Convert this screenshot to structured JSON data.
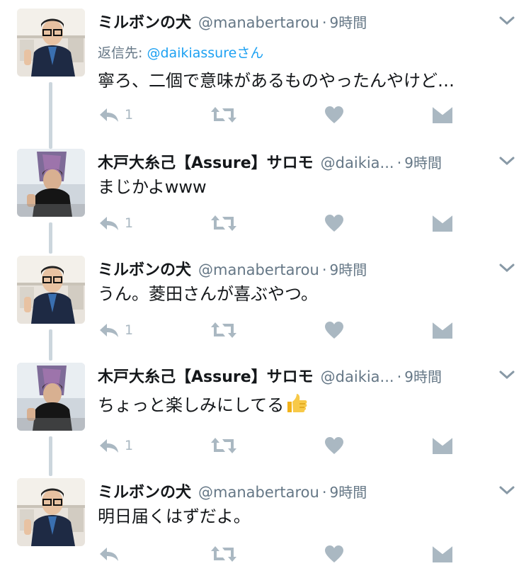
{
  "tweets": [
    {
      "name": "ミルボンの犬",
      "handle": "@manabertarou",
      "time": "9時間",
      "reply_prefix": "返信先: ",
      "reply_mention": "@daikiassure",
      "reply_suffix": "さん",
      "text": "寧ろ、二個で意味があるものやったんやけど…",
      "reply_count": "1",
      "avatar": "man-glasses-avatar"
    },
    {
      "name": "木戸大糸己【Assure】サロモ",
      "handle": "@daikia...",
      "time": "9時間",
      "text": "まじかよwww",
      "reply_count": "1",
      "avatar": "salon-avatar"
    },
    {
      "name": "ミルボンの犬",
      "handle": "@manabertarou",
      "time": "9時間",
      "text": "うん。菱田さんが喜ぶやつ。",
      "reply_count": "1",
      "avatar": "man-glasses-avatar"
    },
    {
      "name": "木戸大糸己【Assure】サロモ",
      "handle": "@daikia...",
      "time": "9時間",
      "text": "ちょっと楽しみにしてる",
      "emoji": "thumbs-up",
      "reply_count": "1",
      "avatar": "salon-avatar"
    },
    {
      "name": "ミルボンの犬",
      "handle": "@manabertarou",
      "time": "9時間",
      "text": "明日届くはずだよ。",
      "reply_count": "",
      "avatar": "man-glasses-avatar"
    }
  ],
  "separator": "·",
  "colors": {
    "text": "#14171a",
    "muted": "#657786",
    "icon": "#aab8c2",
    "link": "#1da1f2",
    "thread_line": "#ccd6dd"
  },
  "icons": [
    "reply-icon",
    "retweet-icon",
    "like-icon",
    "direct-message-icon",
    "chevron-down-icon",
    "thumbs-up-emoji"
  ]
}
